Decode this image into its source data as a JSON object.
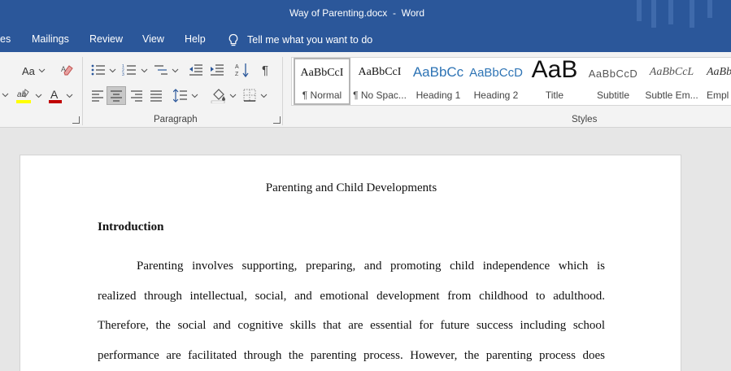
{
  "window": {
    "title": "Way of Parenting.docx  -  Word"
  },
  "tabs": [
    {
      "label": "es"
    },
    {
      "label": "Mailings"
    },
    {
      "label": "Review"
    },
    {
      "label": "View"
    },
    {
      "label": "Help"
    }
  ],
  "tell_me": {
    "text": "Tell me what you want to do",
    "icon": "lightbulb-icon"
  },
  "ribbon": {
    "paragraph_group_label": "Paragraph",
    "styles_group_label": "Styles",
    "font_size_button": "Aa",
    "colors": {
      "highlight": "#ffff00",
      "font_color": "#c00000",
      "accent": "#2b579a"
    },
    "styles": [
      {
        "preview": "AaBbCcI",
        "name": "¶ Normal",
        "selected": true
      },
      {
        "preview": "AaBbCcI",
        "name": "¶ No Spac..."
      },
      {
        "preview": "AaBbCc",
        "name": "Heading 1"
      },
      {
        "preview": "AaBbCcD",
        "name": "Heading 2"
      },
      {
        "preview": "AaB",
        "name": "Title"
      },
      {
        "preview": "AaBbCcD",
        "name": "Subtitle"
      },
      {
        "preview": "AaBbCcL",
        "name": "Subtle Em..."
      },
      {
        "preview": "AaBb",
        "name": "Empl"
      }
    ]
  },
  "document": {
    "title": "Parenting and Child Developments",
    "heading": "Introduction",
    "lines": [
      "Parenting involves supporting, preparing, and promoting child independence which is",
      "realized through intellectual, social, and emotional development from childhood to adulthood.",
      "Therefore, the social and cognitive skills that are essential for future success including school",
      "performance are facilitated through the parenting process. However, the parenting process does"
    ]
  }
}
